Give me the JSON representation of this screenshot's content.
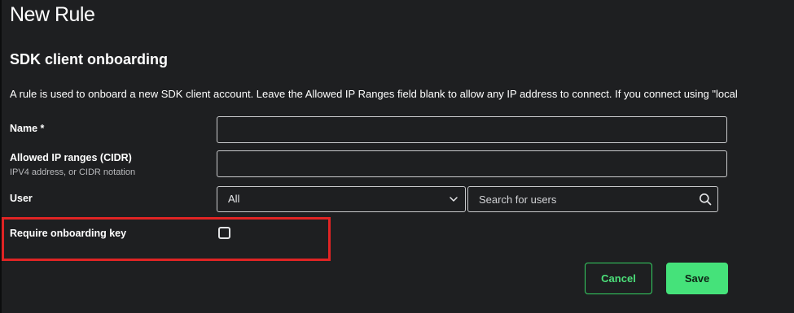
{
  "page": {
    "title": "New Rule"
  },
  "section": {
    "title": "SDK client onboarding",
    "description": "A rule is used to onboard a new SDK client account. Leave the Allowed IP Ranges field blank to allow any IP address to connect. If you connect using \"local"
  },
  "form": {
    "name": {
      "label": "Name *",
      "value": ""
    },
    "allowed_ip": {
      "label": "Allowed IP ranges (CIDR)",
      "sublabel": "IPV4 address, or CIDR notation",
      "value": ""
    },
    "user": {
      "label": "User",
      "selected": "All",
      "search_placeholder": "Search for users"
    },
    "onboarding_key": {
      "label": "Require onboarding key",
      "checked": false
    }
  },
  "actions": {
    "cancel_label": "Cancel",
    "save_label": "Save"
  },
  "colors": {
    "background": "#1e1f21",
    "accent_green": "#45e27a",
    "highlight_red": "#e02424",
    "input_border": "#c9cacc"
  },
  "icons": {
    "select": "chevron-down-icon",
    "search": "search-icon"
  }
}
